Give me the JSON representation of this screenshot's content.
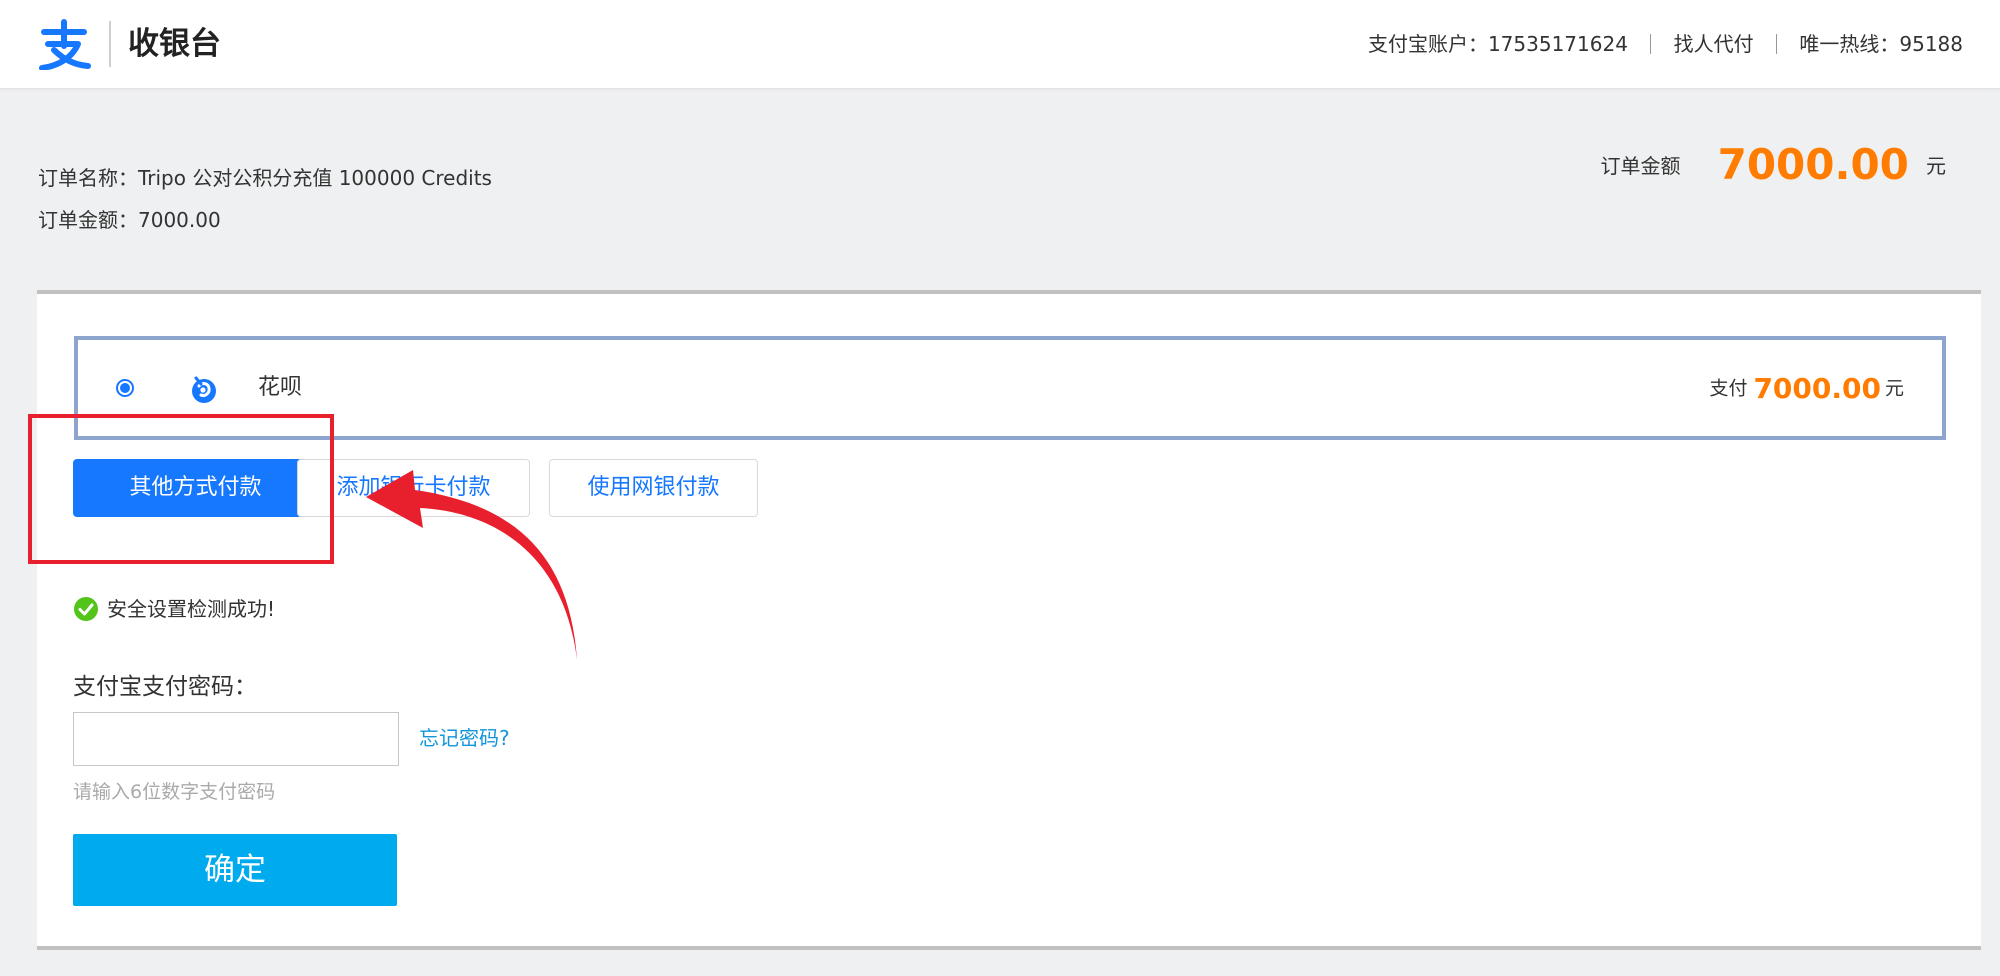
{
  "header": {
    "title": "收银台",
    "account_label": "支付宝账户：",
    "account_number": "17535171624",
    "find_payer_link": "找人代付",
    "hotline_label": "唯一热线：",
    "hotline_number": "95188"
  },
  "order": {
    "name_label": "订单名称：",
    "name_value": "Tripo 公对公积分充值 100000 Credits",
    "amount_label": "订单金额：",
    "amount_value": "7000.00",
    "total_label": "订单金额",
    "total_amount": "7000.00",
    "total_unit": "元"
  },
  "payment_method": {
    "name": "花呗",
    "selected": true,
    "pay_label": "支付",
    "pay_amount": "7000.00",
    "pay_unit": "元"
  },
  "buttons": {
    "other_methods": "其他方式付款",
    "add_bank_card": "添加银行卡付款",
    "online_bank": "使用网银付款",
    "confirm": "确定"
  },
  "security": {
    "status_text": "安全设置检测成功!"
  },
  "password": {
    "label": "支付宝支付密码：",
    "value": "",
    "forgot_link": "忘记密码?",
    "hint": "请输入6位数字支付密码"
  },
  "colors": {
    "brand_blue": "#1677ff",
    "amount_orange": "#ff7c00",
    "confirm_blue": "#00aaee",
    "annotation_red": "#e8202e"
  },
  "icons": {
    "logo": "alipay-logo-icon",
    "huabei": "huabei-icon",
    "check": "check-circle-icon"
  }
}
